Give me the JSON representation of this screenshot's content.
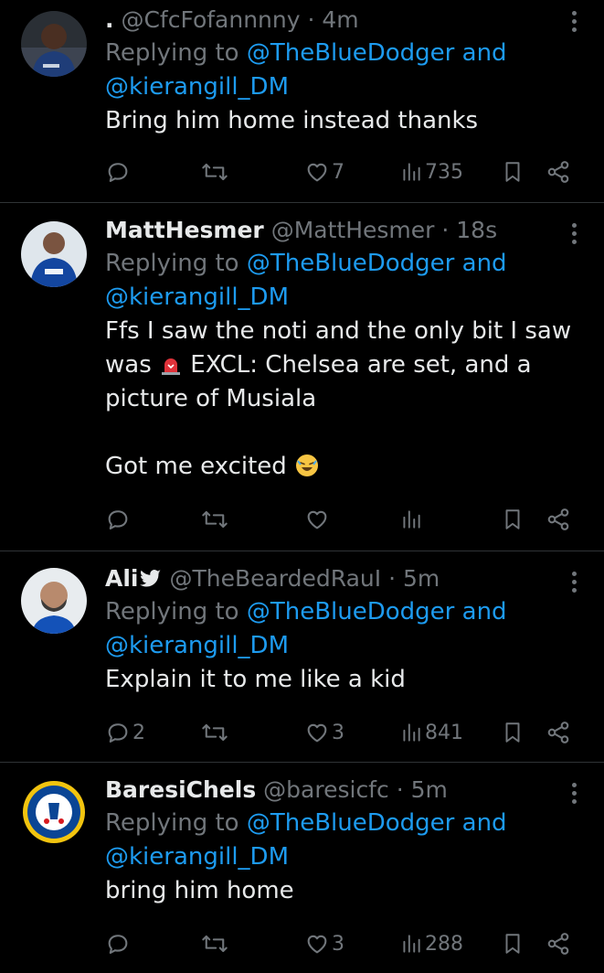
{
  "tweets": [
    {
      "name": "",
      "name_prefix": ".",
      "handle": "@CfcFofannnny",
      "dot": "·",
      "time": "4m",
      "replying_prefix": "Replying to",
      "replying_user1": "@TheBlueDodger",
      "replying_and": "and",
      "replying_user2": "@kierangill_DM",
      "body": "Bring him home instead thanks",
      "replies": "",
      "retweets": "",
      "likes": "7",
      "views": "735"
    },
    {
      "name": "MattHesmer",
      "handle": "@MattHesmer",
      "dot": "·",
      "time": "18s",
      "replying_prefix": "Replying to",
      "replying_user1": "@TheBlueDodger",
      "replying_and": "and",
      "replying_user2": "@kierangill_DM",
      "body_line1": "Ffs I saw the noti and the only bit I saw",
      "body_line2a": "was",
      "body_line2b": "EXCL: Chelsea are set, and a",
      "body_line3": "picture of Musiala",
      "body_line4": "Got me excited",
      "replies": "",
      "retweets": "",
      "likes": "",
      "views": ""
    },
    {
      "name": "Ali",
      "handle": "@TheBeardedRauI",
      "dot": "·",
      "time": "5m",
      "replying_prefix": "Replying to",
      "replying_user1": "@TheBlueDodger",
      "replying_and": "and",
      "replying_user2": "@kierangill_DM",
      "body": "Explain it to me like a kid",
      "replies": "2",
      "retweets": "",
      "likes": "3",
      "views": "841"
    },
    {
      "name": "BaresiChels",
      "handle": "@baresicfc",
      "dot": "·",
      "time": "5m",
      "replying_prefix": "Replying to",
      "replying_user1": "@TheBlueDodger",
      "replying_and": "and",
      "replying_user2": "@kierangill_DM",
      "body": "bring him home",
      "replies": "",
      "retweets": "",
      "likes": "3",
      "views": "288"
    }
  ],
  "colors": {
    "background": "#000000",
    "text": "#e7e9ea",
    "muted": "#71767b",
    "link": "#1d9bf0",
    "divider": "#2f3336"
  },
  "icons": [
    "reply-icon",
    "retweet-icon",
    "like-icon",
    "views-icon",
    "bookmark-icon",
    "share-icon",
    "more-icon",
    "twitter-bird-icon",
    "siren-emoji",
    "laughing-emoji"
  ]
}
